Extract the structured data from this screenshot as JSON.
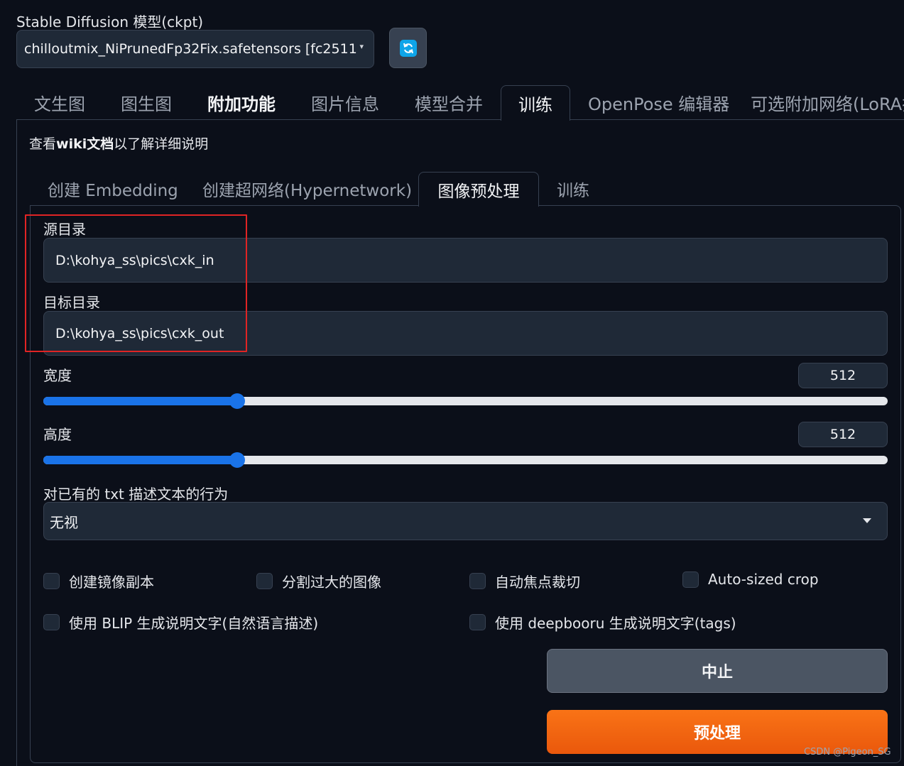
{
  "model": {
    "label": "Stable Diffusion 模型(ckpt)",
    "selected": "chilloutmix_NiPrunedFp32Fix.safetensors [fc2511",
    "refresh_icon": "refresh-icon"
  },
  "top_tabs": [
    "文生图",
    "图生图",
    "附加功能",
    "图片信息",
    "模型合并",
    "训练",
    "OpenPose 编辑器",
    "可选附加网络(LoRA插"
  ],
  "active_top_tab": "训练",
  "wiki": {
    "prefix": "查看",
    "link": "wiki文档",
    "suffix": "以了解详细说明"
  },
  "sub_tabs": [
    "创建 Embedding",
    "创建超网络(Hypernetwork)",
    "图像预处理",
    "训练"
  ],
  "active_sub_tab": "图像预处理",
  "fields": {
    "source_label": "源目录",
    "source_value": "D:\\kohya_ss\\pics\\cxk_in",
    "target_label": "目标目录",
    "target_value": "D:\\kohya_ss\\pics\\cxk_out"
  },
  "width": {
    "label": "宽度",
    "value": "512",
    "fraction": 0.23
  },
  "height": {
    "label": "高度",
    "value": "512",
    "fraction": 0.23
  },
  "txt_action": {
    "label": "对已有的 txt 描述文本的行为",
    "selected": "无视"
  },
  "checkboxes": {
    "mirror": "创建镜像副本",
    "split": "分割过大的图像",
    "focal": "自动焦点裁切",
    "autosize": "Auto-sized crop",
    "blip": "使用 BLIP 生成说明文字(自然语言描述)",
    "deepbooru": "使用 deepbooru 生成说明文字(tags)"
  },
  "buttons": {
    "stop": "中止",
    "preprocess": "预处理"
  },
  "watermark": "CSDN @Pigeon_SG",
  "colors": {
    "accent": "#1a73e8",
    "primary_button": "#f97316",
    "highlight": "#e02424"
  }
}
